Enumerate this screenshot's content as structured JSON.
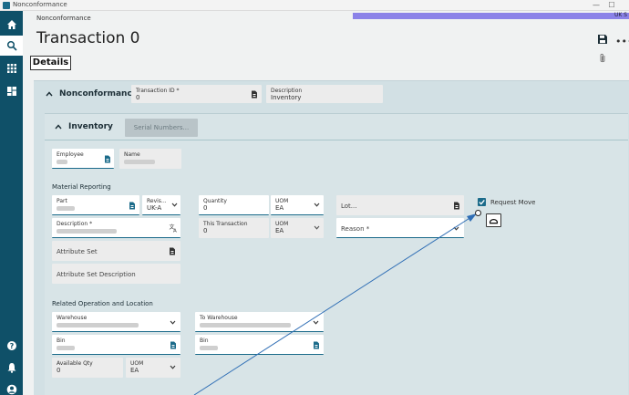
{
  "window": {
    "title": "Nonconformance",
    "minimize": "—",
    "maximize": "☐"
  },
  "header": {
    "breadcrumb": "Nonconformance",
    "title": "Transaction 0",
    "status_strip_text": "UK S",
    "details_tab": "Details"
  },
  "nav": {
    "items": [
      "home-icon",
      "search-icon",
      "apps-icon",
      "dashboard-icon",
      "help-icon",
      "bell-icon",
      "user-icon"
    ]
  },
  "panel": {
    "title": "Nonconformance",
    "transaction_id": {
      "label": "Transaction ID *",
      "value": "0"
    },
    "description": {
      "label": "Description",
      "value": "Inventory"
    }
  },
  "inventory": {
    "title": "Inventory",
    "serial_button": "Serial Numbers...",
    "employee": {
      "label": "Employee",
      "value": ""
    },
    "name": {
      "label": "Name",
      "value": ""
    },
    "material_reporting_label": "Material Reporting",
    "part": {
      "label": "Part",
      "value": ""
    },
    "revision": {
      "label": "Revis...",
      "value": "UK-A"
    },
    "quantity": {
      "label": "Quantity",
      "value": "0"
    },
    "uom1": {
      "label": "UOM",
      "value": "EA"
    },
    "lot": {
      "placeholder": "Lot..."
    },
    "request_move": {
      "label": "Request Move",
      "checked": true
    },
    "part_description": {
      "label": "Description *",
      "value": ""
    },
    "this_transaction": {
      "label": "This Transaction",
      "value": "0"
    },
    "uom2": {
      "label": "UOM",
      "value": "EA"
    },
    "reason": {
      "placeholder": "Reason *"
    },
    "attribute_set": {
      "placeholder": "Attribute Set"
    },
    "attribute_set_description": {
      "placeholder": "Attribute Set Description"
    },
    "related_label": "Related Operation and Location",
    "warehouse": {
      "label": "Warehouse",
      "value": ""
    },
    "to_warehouse": {
      "label": "To Warehouse",
      "value": ""
    },
    "bin": {
      "label": "Bin",
      "value": ""
    },
    "to_bin": {
      "label": "Bin",
      "value": ""
    },
    "available_qty": {
      "label": "Available Qty",
      "value": "0"
    },
    "uom3": {
      "label": "UOM",
      "value": "EA"
    }
  }
}
